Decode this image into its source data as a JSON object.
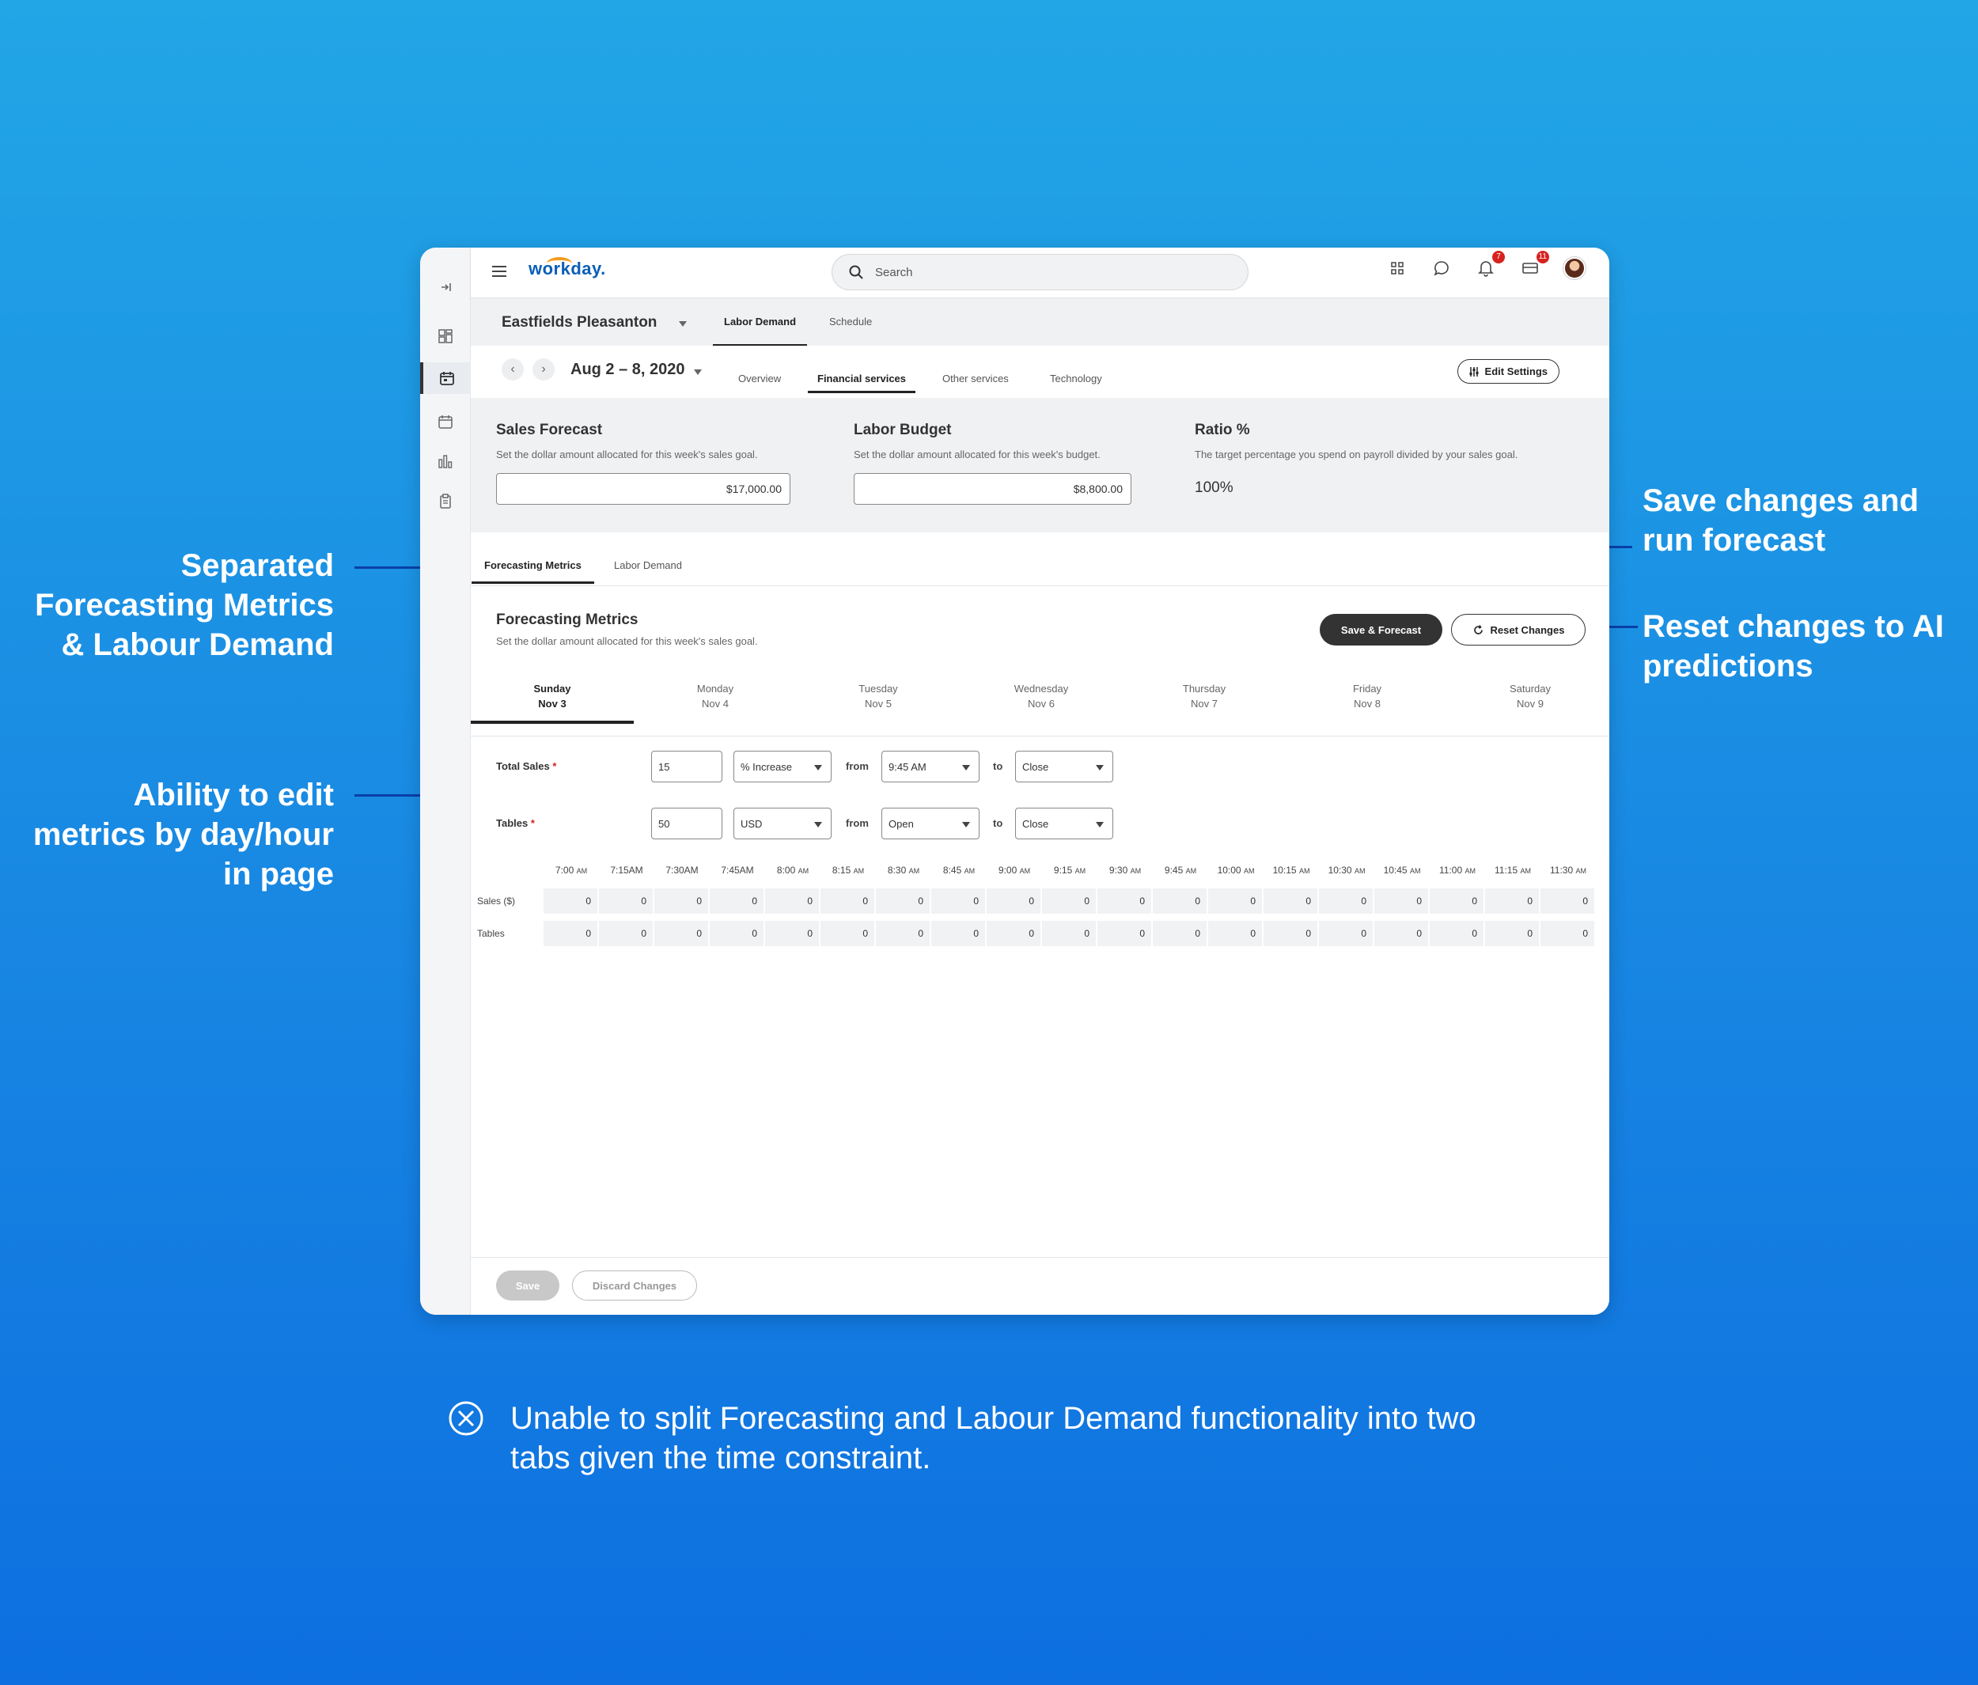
{
  "app": {
    "logo": "workday.",
    "search_placeholder": "Search",
    "badges": {
      "notifications": "7",
      "inbox": "11"
    }
  },
  "header": {
    "store_name": "Eastfields Pleasanton",
    "top_tabs": [
      "Labor Demand",
      "Schedule"
    ],
    "active_top_tab": "Labor Demand",
    "date_range": "Aug 2 – 8, 2020",
    "sub_tabs": [
      "Overview",
      "Financial services",
      "Other services",
      "Technology"
    ],
    "active_sub_tab": "Financial services",
    "edit_settings": "Edit Settings"
  },
  "summary": {
    "sales_forecast": {
      "title": "Sales Forecast",
      "desc": "Set the dollar amount allocated for this week's sales goal.",
      "value": "$17,000.00"
    },
    "labor_budget": {
      "title": "Labor Budget",
      "desc": "Set the dollar amount allocated for this week's budget.",
      "value": "$8,800.00"
    },
    "ratio": {
      "title": "Ratio %",
      "desc": "The target percentage you spend on payroll divided by your sales goal.",
      "value": "100%"
    }
  },
  "section_tabs": [
    "Forecasting Metrics",
    "Labor Demand"
  ],
  "forecasting": {
    "title": "Forecasting Metrics",
    "desc": "Set the dollar amount allocated for this week's sales goal.",
    "save_forecast": "Save & Forecast",
    "reset_changes": "Reset Changes"
  },
  "days": [
    {
      "day": "Sunday",
      "date": "Nov 3"
    },
    {
      "day": "Monday",
      "date": "Nov 4"
    },
    {
      "day": "Tuesday",
      "date": "Nov 5"
    },
    {
      "day": "Wednesday",
      "date": "Nov 6"
    },
    {
      "day": "Thursday",
      "date": "Nov 7"
    },
    {
      "day": "Friday",
      "date": "Nov 8"
    },
    {
      "day": "Saturday",
      "date": "Nov 9"
    }
  ],
  "form": {
    "total_sales": {
      "label": "Total Sales",
      "value": "15",
      "unit": "% Increase",
      "from_word": "from",
      "from": "9:45 AM",
      "to_word": "to",
      "to": "Close"
    },
    "tables": {
      "label": "Tables",
      "value": "50",
      "unit": "USD",
      "from_word": "from",
      "from": "Open",
      "to_word": "to",
      "to": "Close"
    }
  },
  "grid": {
    "times": [
      [
        "7:00",
        "AM"
      ],
      [
        "7:15AM",
        ""
      ],
      [
        "7:30AM",
        ""
      ],
      [
        "7:45AM",
        ""
      ],
      [
        "8:00",
        "AM"
      ],
      [
        "8:15",
        "AM"
      ],
      [
        "8:30",
        "AM"
      ],
      [
        "8:45",
        "AM"
      ],
      [
        "9:00",
        "AM"
      ],
      [
        "9:15",
        "AM"
      ],
      [
        "9:30",
        "AM"
      ],
      [
        "9:45",
        "AM"
      ],
      [
        "10:00",
        "AM"
      ],
      [
        "10:15",
        "AM"
      ],
      [
        "10:30",
        "AM"
      ],
      [
        "10:45",
        "AM"
      ],
      [
        "11:00",
        "AM"
      ],
      [
        "11:15",
        "AM"
      ],
      [
        "11:30",
        "AM"
      ]
    ],
    "rows": [
      {
        "label": "Sales ($)",
        "values": [
          "0",
          "0",
          "0",
          "0",
          "0",
          "0",
          "0",
          "0",
          "0",
          "0",
          "0",
          "0",
          "0",
          "0",
          "0",
          "0",
          "0",
          "0",
          "0"
        ]
      },
      {
        "label": "Tables",
        "values": [
          "0",
          "0",
          "0",
          "0",
          "0",
          "0",
          "0",
          "0",
          "0",
          "0",
          "0",
          "0",
          "0",
          "0",
          "0",
          "0",
          "0",
          "0",
          "0"
        ]
      }
    ]
  },
  "footer": {
    "save": "Save",
    "discard": "Discard Changes"
  },
  "annotations": {
    "separated": [
      "Separated",
      "Forecasting Metrics",
      "& Labour Demand"
    ],
    "edit": [
      "Ability to edit",
      "metrics by day/hour",
      "in page"
    ],
    "save": [
      "Save changes and",
      "run forecast"
    ],
    "reset": [
      "Reset changes to AI",
      "predictions"
    ],
    "note": "Unable to split Forecasting and Labour Demand functionality into two tabs given the time constraint."
  },
  "colors": {
    "dark": "#333333",
    "badge": "#d6231f",
    "annotation_line": "#0a3fa8",
    "logo": "#0a5eb8"
  }
}
